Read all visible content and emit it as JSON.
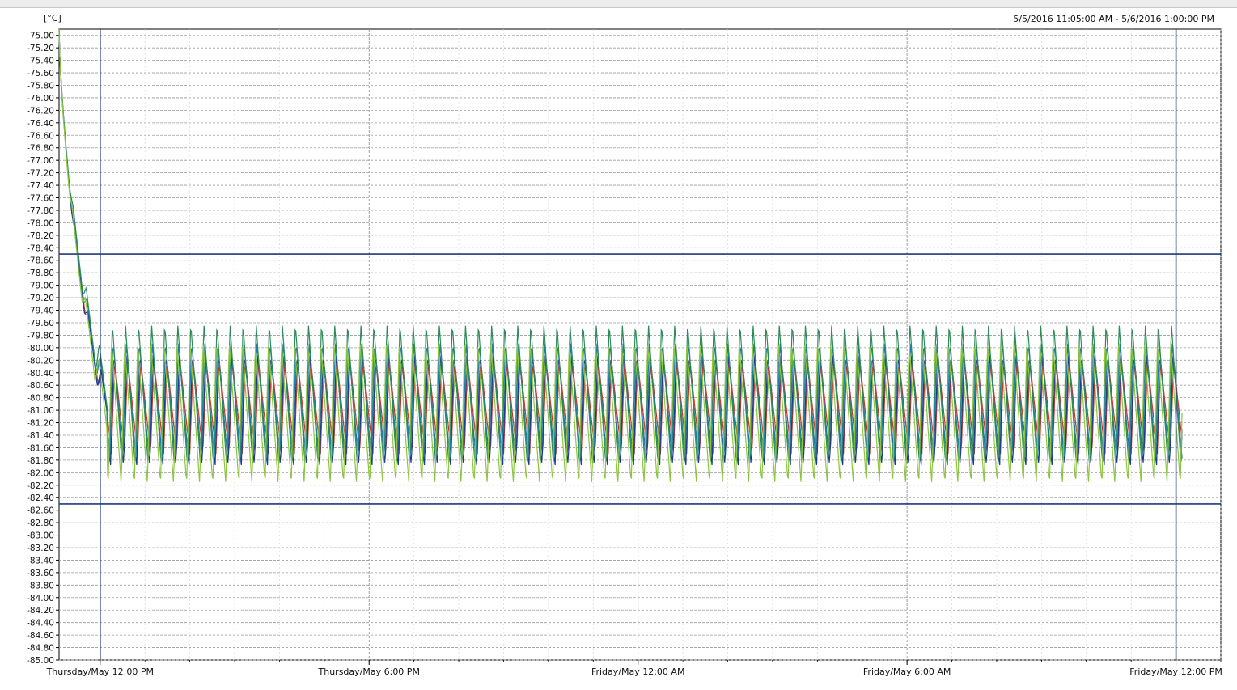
{
  "header": {
    "unit_label": "[°C]",
    "range_label": "5/5/2016 11:05:00 AM - 5/6/2016 1:00:00 PM"
  },
  "chart_data": {
    "type": "line",
    "title": "",
    "xlabel": "",
    "ylabel": "[°C]",
    "x_range": [
      "2016-05-05 11:05",
      "2016-05-06 13:00"
    ],
    "ylim": [
      -85.0,
      -74.9
    ],
    "y_ticks": [
      "-75.00",
      "-75.20",
      "-75.40",
      "-75.60",
      "-75.80",
      "-76.00",
      "-76.20",
      "-76.40",
      "-76.60",
      "-76.80",
      "-77.00",
      "-77.20",
      "-77.40",
      "-77.60",
      "-77.80",
      "-78.00",
      "-78.20",
      "-78.40",
      "-78.60",
      "-78.80",
      "-79.00",
      "-79.20",
      "-79.40",
      "-79.60",
      "-79.80",
      "-80.00",
      "-80.20",
      "-80.40",
      "-80.60",
      "-80.80",
      "-81.00",
      "-81.20",
      "-81.40",
      "-81.60",
      "-81.80",
      "-82.00",
      "-82.20",
      "-82.40",
      "-82.60",
      "-82.80",
      "-83.00",
      "-83.20",
      "-83.40",
      "-83.60",
      "-83.80",
      "-84.00",
      "-84.20",
      "-84.40",
      "-84.60",
      "-84.80",
      "-85.00"
    ],
    "x_ticks": [
      {
        "label": "Thursday/May 12:00 PM",
        "time": "2016-05-05 12:00"
      },
      {
        "label": "Thursday/May 6:00 PM",
        "time": "2016-05-05 18:00"
      },
      {
        "label": "Friday/May 12:00 AM",
        "time": "2016-05-06 00:00"
      },
      {
        "label": "Friday/May 6:00 AM",
        "time": "2016-05-06 06:00"
      },
      {
        "label": "Friday/May 12:00 PM",
        "time": "2016-05-06 12:00"
      }
    ],
    "limit_lines_y": [
      -78.5,
      -82.5
    ],
    "cursor_lines_x": [
      "2016-05-05 12:00",
      "2016-05-06 12:00"
    ],
    "grid": true,
    "cycle_minutes": 17.5,
    "series": [
      {
        "color": "#c0392b",
        "start": -74.9,
        "settle_time": "2016-05-05 12:10",
        "high": -80.2,
        "low": -81.7
      },
      {
        "color": "#1f3a93",
        "start": -74.9,
        "settle_time": "2016-05-05 12:10",
        "high": -80.1,
        "low": -81.9
      },
      {
        "color": "#1a7fa0",
        "start": -74.9,
        "settle_time": "2016-05-05 12:10",
        "high": -79.9,
        "low": -81.8
      },
      {
        "color": "#2e8b57",
        "start": -74.9,
        "settle_time": "2016-05-05 12:10",
        "high": -79.6,
        "low": -81.9
      },
      {
        "color": "#8cc63f",
        "start": -74.9,
        "settle_time": "2016-05-05 12:10",
        "high": -79.9,
        "low": -82.2
      }
    ]
  }
}
